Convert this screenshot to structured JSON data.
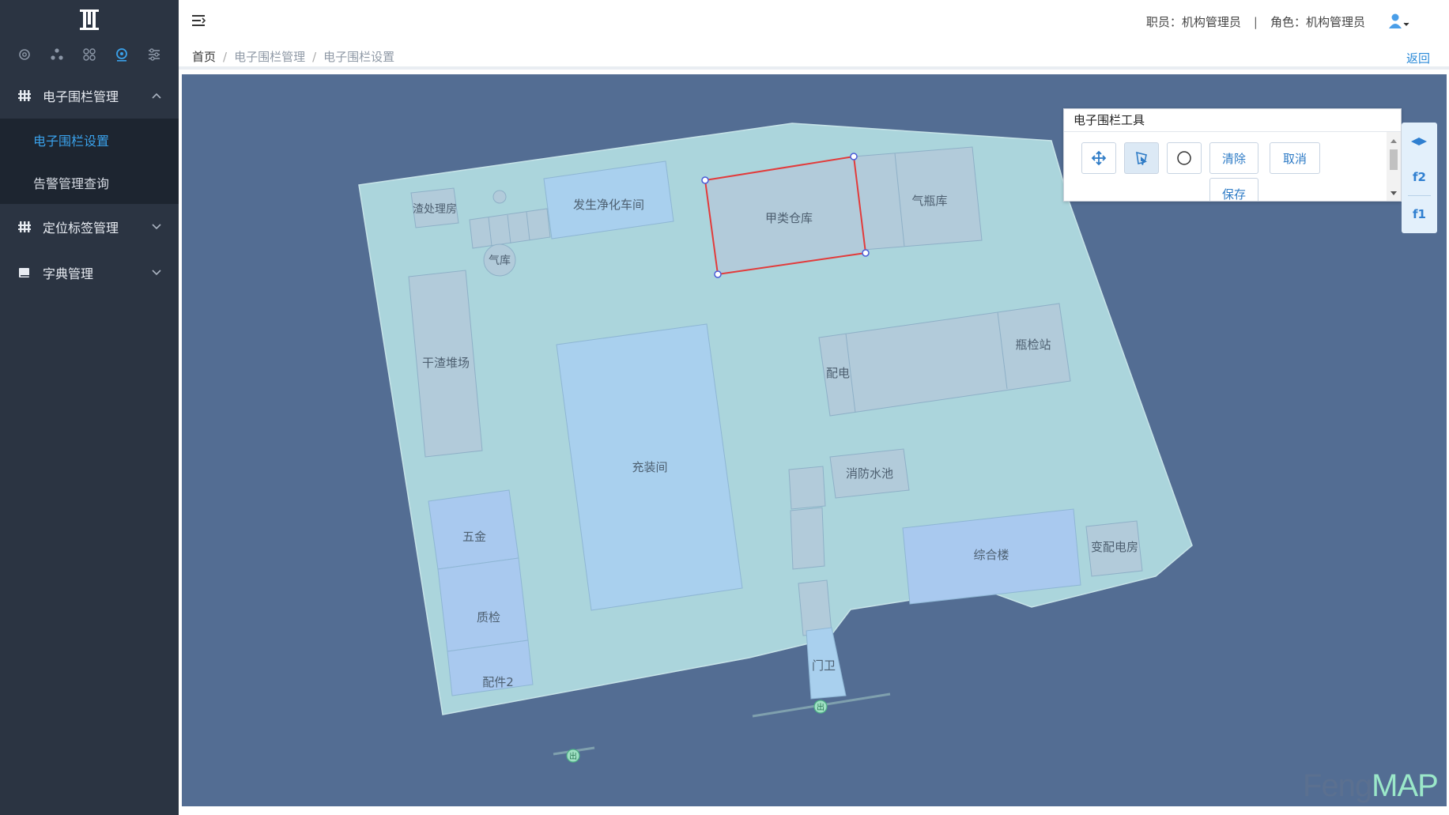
{
  "sidebar": {
    "menus": [
      {
        "label": "电子围栏管理",
        "expanded": true,
        "items": [
          {
            "label": "电子围栏设置",
            "active": true
          },
          {
            "label": "告警管理查询",
            "active": false
          }
        ]
      },
      {
        "label": "定位标签管理",
        "expanded": false,
        "items": []
      },
      {
        "label": "字典管理",
        "expanded": false,
        "items": []
      }
    ],
    "icon_bar": [
      "settings-icon",
      "share-icon",
      "grid-icon",
      "location-icon",
      "filter-icon"
    ]
  },
  "header": {
    "staff": "职员：机构管理员",
    "separator": "|",
    "role": "角色：机构管理员"
  },
  "breadcrumb": {
    "home": "首页",
    "sep": "/",
    "level1": "电子围栏管理",
    "level2": "电子围栏设置",
    "back": "返回"
  },
  "map": {
    "labels": {
      "wastewater": "渣处理房",
      "gas_purify": "发生净化车间",
      "warehouse_a": "甲类仓库",
      "gas_store": "气瓶库",
      "gas_cab": "气库",
      "dry_slag": "干渣堆场",
      "filling": "充装间",
      "power": "配电",
      "bottle_check": "瓶检站",
      "fire_pool": "消防水池",
      "hardware": "五金",
      "qc": "质检",
      "parts": "配件2",
      "office": "综合楼",
      "substation": "变配电房",
      "gate": "门卫"
    },
    "door_marker": "出"
  },
  "tool_panel": {
    "title": "电子围栏工具",
    "clear": "清除",
    "cancel": "取消",
    "save": "保存",
    "tools": [
      "move-icon",
      "select-icon",
      "circle-icon"
    ]
  },
  "floors": [
    "f2",
    "f1"
  ],
  "watermark": {
    "part1": "Feng",
    "part2": "MAP"
  },
  "colors": {
    "sidebar_bg": "#2b3442",
    "active_menu": "#3aa1ea",
    "map_bg": "#536d93",
    "ground": "#a9d4da",
    "building": "#adc8d8",
    "building_blue": "#a9d0ee",
    "fence": "#e23b3b"
  }
}
